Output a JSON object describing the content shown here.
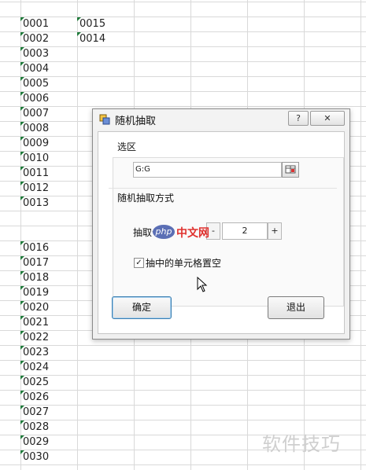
{
  "sheet": {
    "columnA": [
      "0001",
      "0002",
      "0003",
      "0004",
      "0005",
      "0006",
      "0007",
      "0008",
      "0009",
      "0010",
      "0011",
      "0012",
      "0013",
      "",
      "",
      "0016",
      "0017",
      "0018",
      "0019",
      "0020",
      "0021",
      "0022",
      "0023",
      "0024",
      "0025",
      "0026",
      "0027",
      "0028",
      "0029",
      "0030"
    ],
    "columnB": [
      "0015",
      "0014"
    ]
  },
  "dialog": {
    "title": "随机抽取",
    "help_label": "?",
    "close_label": "✕",
    "section_selection": "选区",
    "selection_value": "G:G",
    "section_method": "随机抽取方式",
    "count_label": "抽取个数:",
    "count_minus": "-",
    "count_value": "2",
    "count_plus": "+",
    "checkbox_checked": "✓",
    "checkbox_label": "抽中的单元格置空",
    "ok_label": "确定",
    "exit_label": "退出"
  },
  "watermarks": {
    "php_badge": "php",
    "php_site": "中文网",
    "corner_text": "软件技巧"
  },
  "colors": {
    "cell_marker": "#1f7a3a",
    "default_button_border": "#3c7fb1"
  }
}
